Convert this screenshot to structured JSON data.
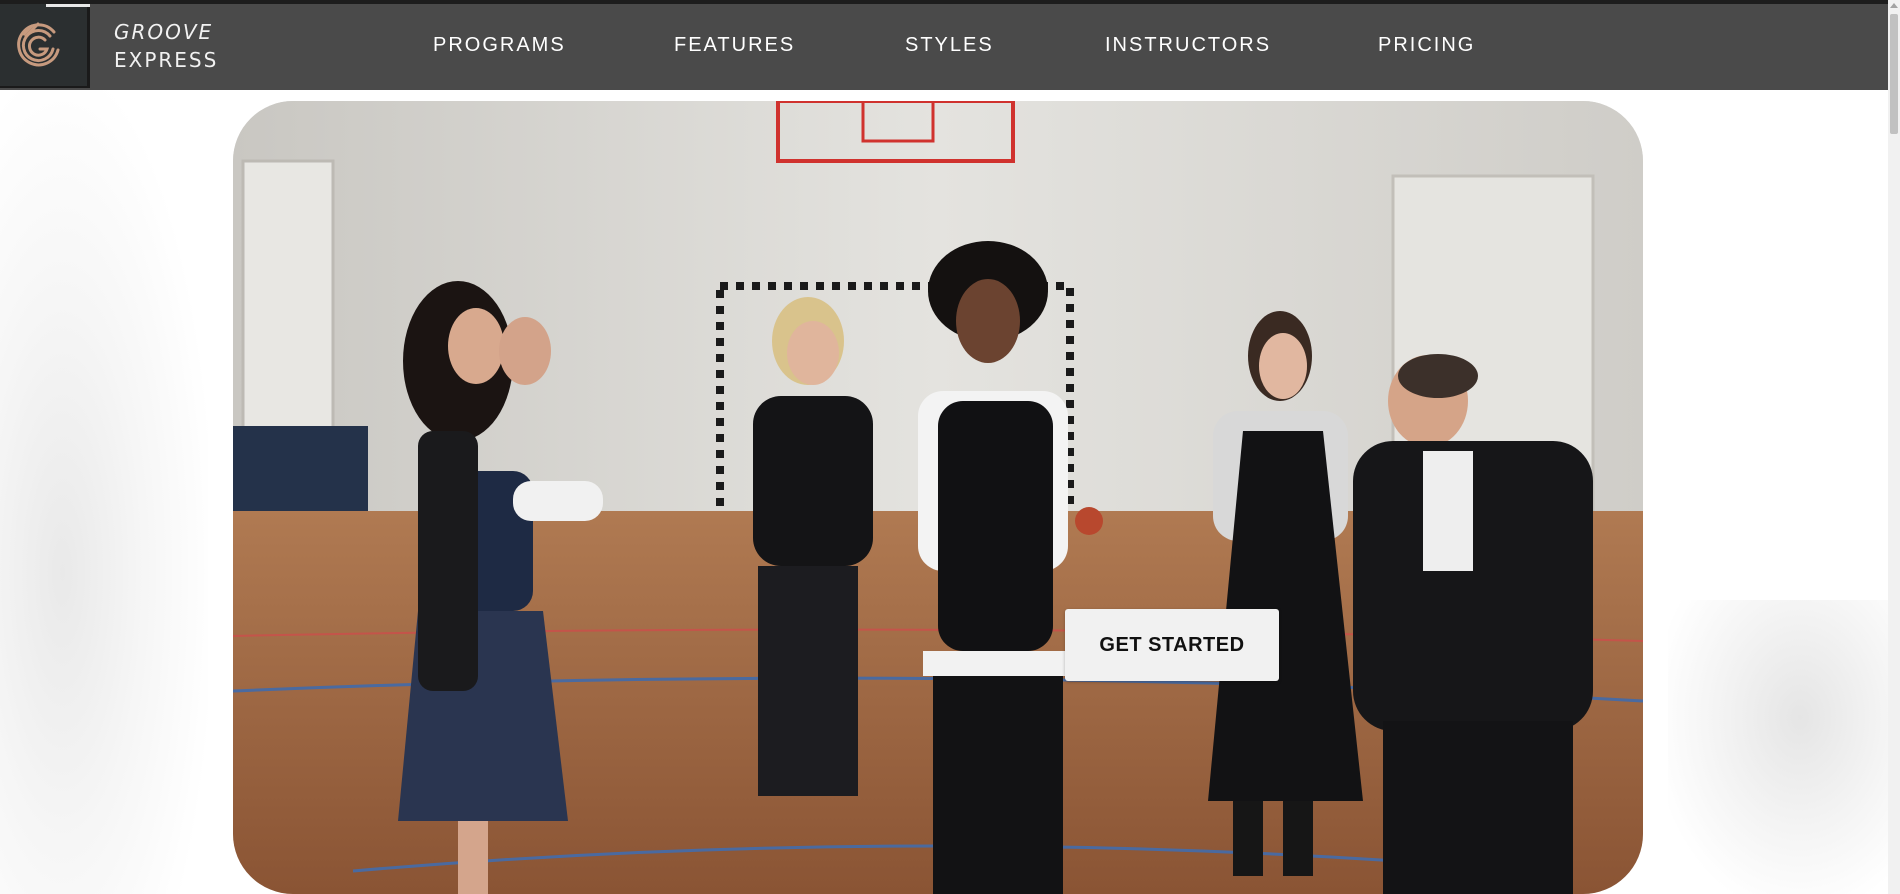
{
  "brand": {
    "line1": "GROOVE",
    "line2": "EXPRESS",
    "logo_icon": "g-swirl-logo-icon"
  },
  "nav": {
    "items": [
      {
        "label": "PROGRAMS"
      },
      {
        "label": "FEATURES"
      },
      {
        "label": "STYLES"
      },
      {
        "label": "INSTRUCTORS"
      },
      {
        "label": "PRICING"
      }
    ]
  },
  "hero": {
    "cta_label": "GET STARTED",
    "image_subject": "dancers-in-gym-photo"
  },
  "colors": {
    "navbar_bg": "#4a4a4a",
    "logo_accent": "#c79a7e",
    "cta_bg": "#f1f1f1"
  }
}
